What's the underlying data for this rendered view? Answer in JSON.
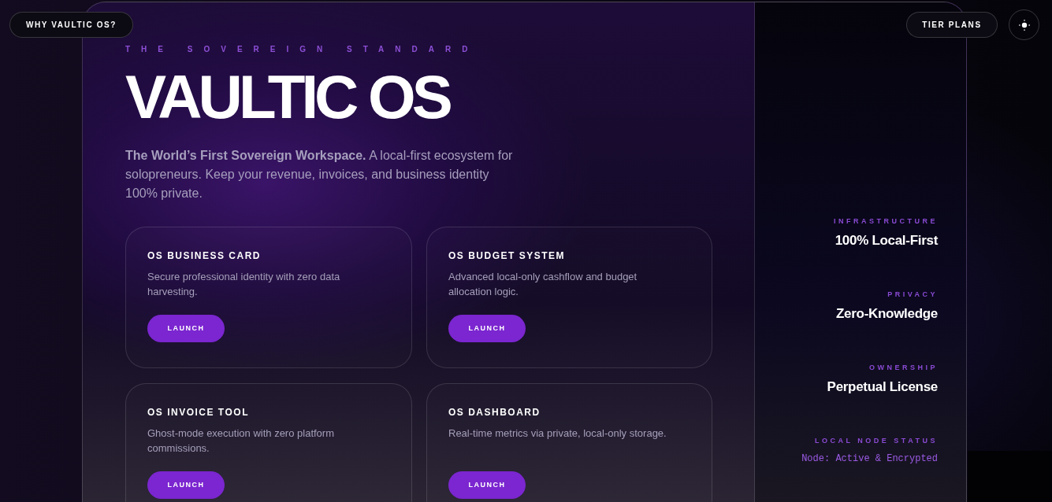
{
  "nav": {
    "left_button": "WHY VAULTIC OS?",
    "right_button": "TIER PLANS"
  },
  "hero": {
    "eyebrow": "THE SOVEREIGN STANDARD",
    "title": "VAULTIC OS",
    "intro": "**The World’s First Sovereign Workspace.** A local-first ecosystem for solopreneurs. Keep your revenue, invoices, and business identity 100% private."
  },
  "tools": [
    {
      "title": "OS BUSINESS CARD",
      "description": "Secure professional identity with zero data harvesting.",
      "button": "LAUNCH"
    },
    {
      "title": "OS BUDGET SYSTEM",
      "description": "Advanced local-only cashflow and budget allocation logic.",
      "button": "LAUNCH"
    },
    {
      "title": "OS INVOICE TOOL",
      "description": "Ghost-mode execution with zero platform commissions.",
      "button": "LAUNCH"
    },
    {
      "title": "OS DASHBOARD",
      "description": "Real-time metrics via private, local-only storage.",
      "button": "LAUNCH"
    }
  ],
  "features": [
    {
      "label": "INFRASTRUCTURE",
      "value": "100% Local-First"
    },
    {
      "label": "PRIVACY",
      "value": "Zero-Knowledge"
    },
    {
      "label": "OWNERSHIP",
      "value": "Perpetual License"
    }
  ],
  "status": {
    "label": "LOCAL NODE STATUS",
    "value": "Node: Active & Encrypted"
  }
}
